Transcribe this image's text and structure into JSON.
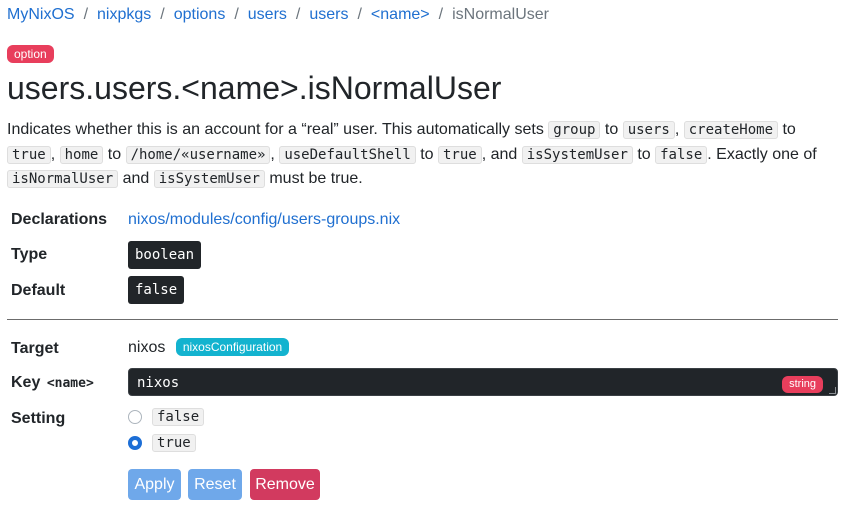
{
  "breadcrumb": {
    "items": [
      "MyNixOS",
      "nixpkgs",
      "options",
      "users",
      "users",
      "<name>"
    ],
    "current": "isNormalUser",
    "separator": "/"
  },
  "option_badge": "option",
  "title": "users.users.<name>.isNormalUser",
  "description": {
    "t1": "Indicates whether this is an account for a “real” user. This automatically sets ",
    "c1": "group",
    "t2": " to ",
    "c2": "users",
    "t3": ", ",
    "c3": "createHome",
    "t4": " to ",
    "c4": "true",
    "t5": ", ",
    "c5": "home",
    "t6": " to ",
    "c6": "/home/«username»",
    "t7": ", ",
    "c7": "useDefaultShell",
    "t8": " to ",
    "c8": "true",
    "t9": ", and ",
    "c9": "isSystemUser",
    "t10": " to ",
    "c10": "false",
    "t11": ". Exactly one of ",
    "c11": "isNormalUser",
    "t12": " and ",
    "c12": "isSystemUser",
    "t13": " must be true."
  },
  "declarations": {
    "label": "Declarations",
    "value": "nixos/modules/config/users-groups.nix"
  },
  "type": {
    "label": "Type",
    "value": "boolean"
  },
  "default": {
    "label": "Default",
    "value": "false"
  },
  "target": {
    "label": "Target",
    "value": "nixos",
    "badge": "nixosConfiguration"
  },
  "key": {
    "label": "Key",
    "param": "<name>",
    "value": "nixos",
    "badge": "string"
  },
  "setting": {
    "label": "Setting",
    "options": [
      {
        "value": "false",
        "checked": false
      },
      {
        "value": "true",
        "checked": true
      }
    ]
  },
  "buttons": {
    "apply": "Apply",
    "reset": "Reset",
    "remove": "Remove"
  },
  "colors": {
    "link": "#1f6fd0",
    "badge_red": "#e83e5c",
    "badge_cyan": "#13b3cf",
    "button_primary": "#6fa8ea",
    "button_danger": "#d23a5f",
    "dark_field": "#212529"
  }
}
